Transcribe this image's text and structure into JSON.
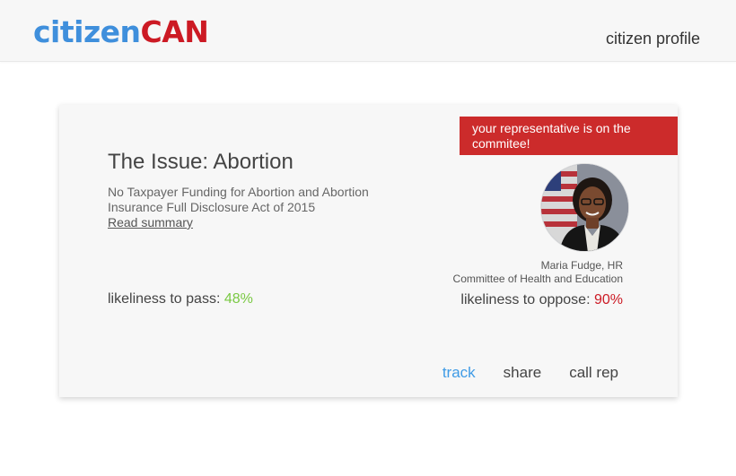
{
  "header": {
    "logo_part1": "citizen",
    "logo_part2": "CAN",
    "profile_link": "citizen profile"
  },
  "card": {
    "banner": "your representative is on the commitee!",
    "issue_title": "The Issue: Abortion",
    "bill_name": "No Taxpayer Funding for Abortion and Abortion Insurance Full Disclosure Act of 2015",
    "read_summary": "Read summary",
    "rep_name": "Maria Fudge, HR",
    "rep_committee": "Committee of Health and Education",
    "pass_label": "likeliness to pass:",
    "pass_value": "48%",
    "oppose_label": "likeliness to oppose:",
    "oppose_value": "90%",
    "actions": {
      "track": "track",
      "share": "share",
      "call_rep": "call rep"
    }
  },
  "colors": {
    "brand_blue": "#3f8fdc",
    "brand_red": "#cc1a24",
    "banner_red": "#cc2b2b",
    "pass_green": "#7ac943",
    "track_blue": "#3f9be6"
  }
}
